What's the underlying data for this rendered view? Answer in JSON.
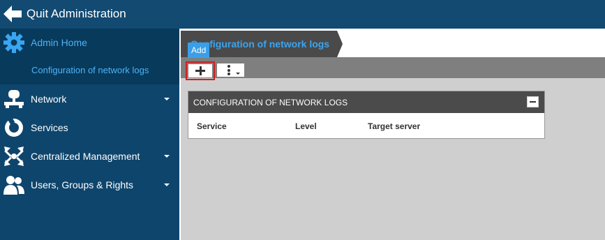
{
  "app": {
    "title": "Quit Administration",
    "back_icon": "back-arrow-icon"
  },
  "sidebar": {
    "home": {
      "label": "Admin Home",
      "icon": "gear-icon"
    },
    "sub_item": {
      "label": "Configuration of network logs"
    },
    "items": [
      {
        "label": "Network",
        "icon": "network-icon",
        "has_caret": true
      },
      {
        "label": "Services",
        "icon": "services-icon",
        "has_caret": false
      },
      {
        "label": "Centralized Management",
        "icon": "centralized-management-icon",
        "has_caret": true
      },
      {
        "label": "Users, Groups & Rights",
        "icon": "users-icon",
        "has_caret": true
      }
    ],
    "accent_color": "#4db3f5"
  },
  "main": {
    "breadcrumb": "Configuration of network logs",
    "toolbar": {
      "add_tooltip": "Add",
      "add_icon": "plus-icon",
      "more_icon": "more-vertical-icon"
    },
    "panel": {
      "title": "CONFIGURATION OF NETWORK LOGS",
      "collapse_icon": "minus-icon",
      "columns": [
        "Service",
        "Level",
        "Target server"
      ]
    }
  },
  "colors": {
    "highlight_border": "#cf1f1f",
    "tooltip_bg": "#3a9fe8"
  }
}
